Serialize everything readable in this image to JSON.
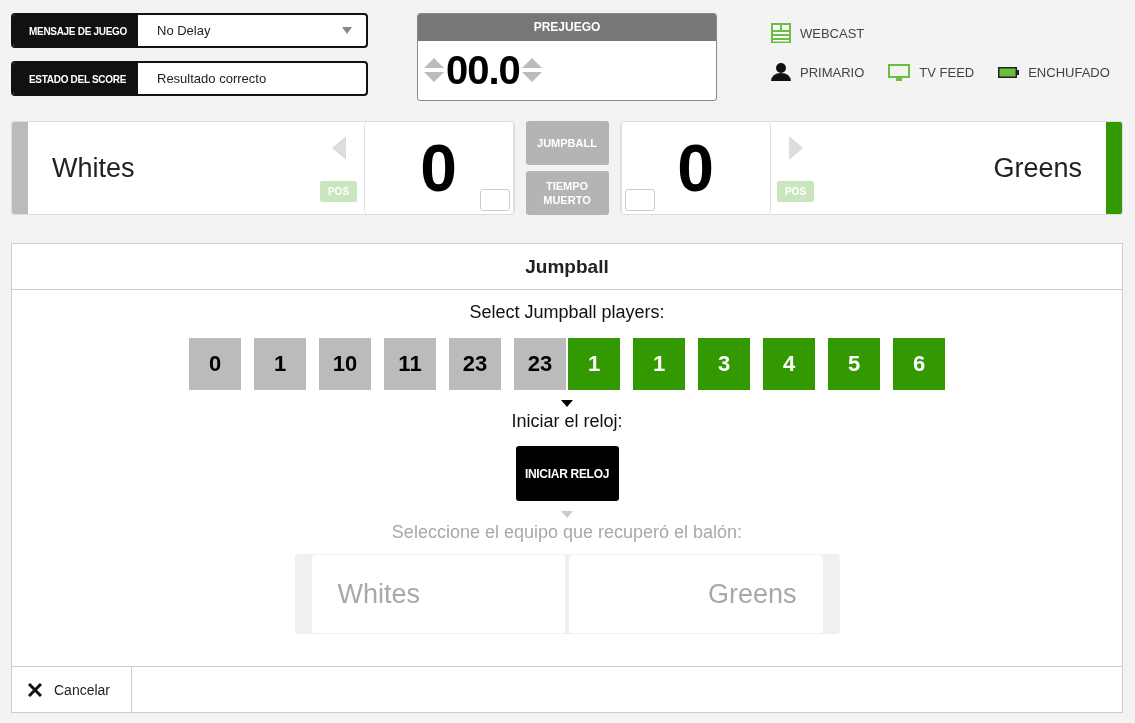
{
  "fields": [
    {
      "label": "MENSAJE DE JUEGO",
      "value": "No Delay",
      "kind": "dropdown"
    },
    {
      "label": "ESTADO DEL SCORE",
      "value": "Resultado correcto",
      "kind": "text"
    }
  ],
  "clock": {
    "title": "PREJUEGO",
    "time": "00.0"
  },
  "status_rows": [
    [
      {
        "label": "WEBCAST",
        "kind": "scoreboard"
      }
    ],
    [
      {
        "label": "PRIMARIO",
        "kind": "person"
      },
      {
        "label": "TV FEED",
        "kind": "monitor"
      },
      {
        "label": "ENCHUFADO",
        "kind": "battery"
      }
    ]
  ],
  "teams": [
    {
      "name": "Whites",
      "score": "0",
      "color": "#bbbbbb",
      "pos": "POS",
      "players": [
        {
          "number": "0",
          "selected": false
        },
        {
          "number": "1",
          "selected": false
        },
        {
          "number": "10",
          "selected": false
        },
        {
          "number": "11",
          "selected": false
        },
        {
          "number": "23",
          "selected": false
        },
        {
          "number": "23",
          "selected": false
        }
      ]
    },
    {
      "name": "Greens",
      "score": "0",
      "color": "#339900",
      "pos": "POS",
      "players": [
        {
          "number": "1",
          "selected": false
        },
        {
          "number": "1",
          "selected": false
        },
        {
          "number": "3",
          "selected": false
        },
        {
          "number": "4",
          "selected": false
        },
        {
          "number": "5",
          "selected": false
        },
        {
          "number": "6",
          "selected": false
        }
      ]
    }
  ],
  "middle_buttons": [
    "JUMPBALL",
    "TIEMPO MUERTO"
  ],
  "panel": {
    "title": "Jumpball",
    "prompt": "Select Jumpball players:",
    "clock_prompt": "Iniciar el reloj:",
    "clock_button": "INICIAR RELOJ",
    "recover_prompt": "Seleccione el equipo que recuperó el balón:",
    "recover_disabled": true,
    "recover_teams": [
      "Whites",
      "Greens"
    ],
    "cancel": "Cancelar"
  }
}
